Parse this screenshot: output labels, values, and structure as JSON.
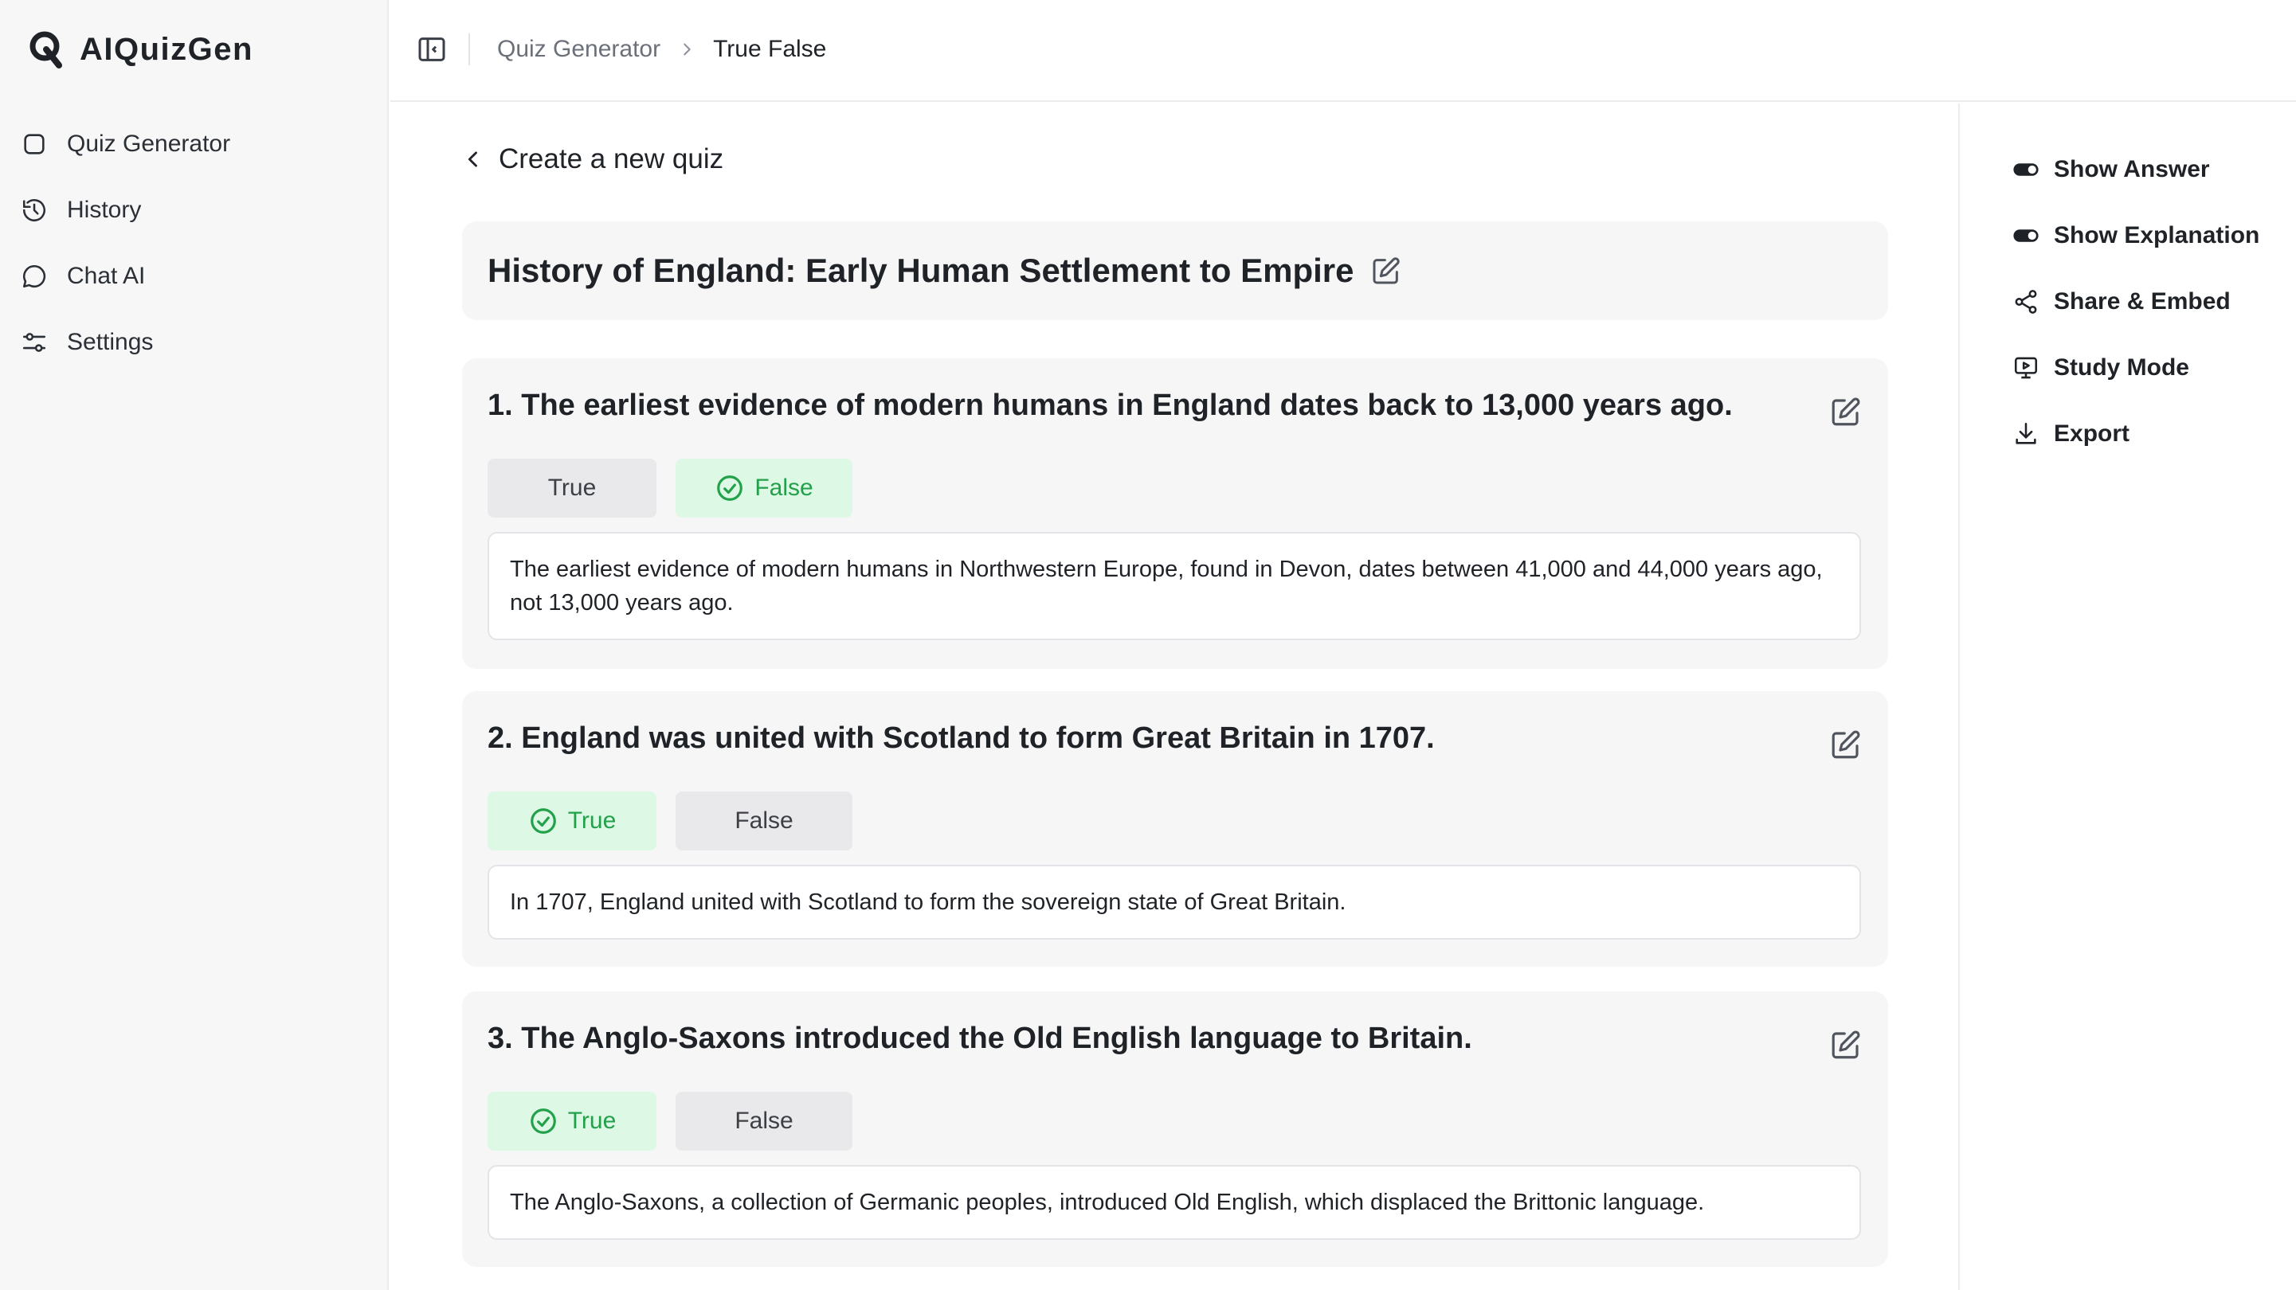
{
  "app": {
    "name": "AIQuizGen"
  },
  "sidebar": {
    "items": [
      {
        "label": "Quiz Generator",
        "icon": "square-icon"
      },
      {
        "label": "History",
        "icon": "history-icon"
      },
      {
        "label": "Chat AI",
        "icon": "chat-bubble-icon"
      },
      {
        "label": "Settings",
        "icon": "sliders-icon"
      }
    ]
  },
  "breadcrumb": {
    "parent": "Quiz Generator",
    "current": "True False"
  },
  "main": {
    "back_label": "Create a new quiz",
    "quiz_title": "History of England: Early Human Settlement to Empire",
    "questions": [
      {
        "text": "1. The earliest evidence of modern humans in England dates back to 13,000 years ago.",
        "options": [
          "True",
          "False"
        ],
        "correct": "False",
        "explanation": "The earliest evidence of modern humans in Northwestern Europe, found in Devon, dates between 41,000 and 44,000 years ago, not 13,000 years ago."
      },
      {
        "text": "2. England was united with Scotland to form Great Britain in 1707.",
        "options": [
          "True",
          "False"
        ],
        "correct": "True",
        "explanation": "In 1707, England united with Scotland to form the sovereign state of Great Britain."
      },
      {
        "text": "3. The Anglo-Saxons introduced the Old English language to Britain.",
        "options": [
          "True",
          "False"
        ],
        "correct": "True",
        "explanation": "The Anglo-Saxons, a collection of Germanic peoples, introduced Old English, which displaced the Brittonic language."
      }
    ]
  },
  "right_panel": {
    "actions": [
      {
        "label": "Show Answer",
        "icon": "toggle-icon"
      },
      {
        "label": "Show Explanation",
        "icon": "toggle-icon"
      },
      {
        "label": "Share & Embed",
        "icon": "share-icon"
      },
      {
        "label": "Study Mode",
        "icon": "presentation-icon"
      },
      {
        "label": "Export",
        "icon": "download-icon"
      }
    ]
  },
  "colors": {
    "correct_bg": "#ddf9e6",
    "correct_text": "#22a04a",
    "option_bg": "#e9e9eb",
    "card_bg": "#f6f6f7",
    "sidebar_bg": "#f7f7f8"
  }
}
